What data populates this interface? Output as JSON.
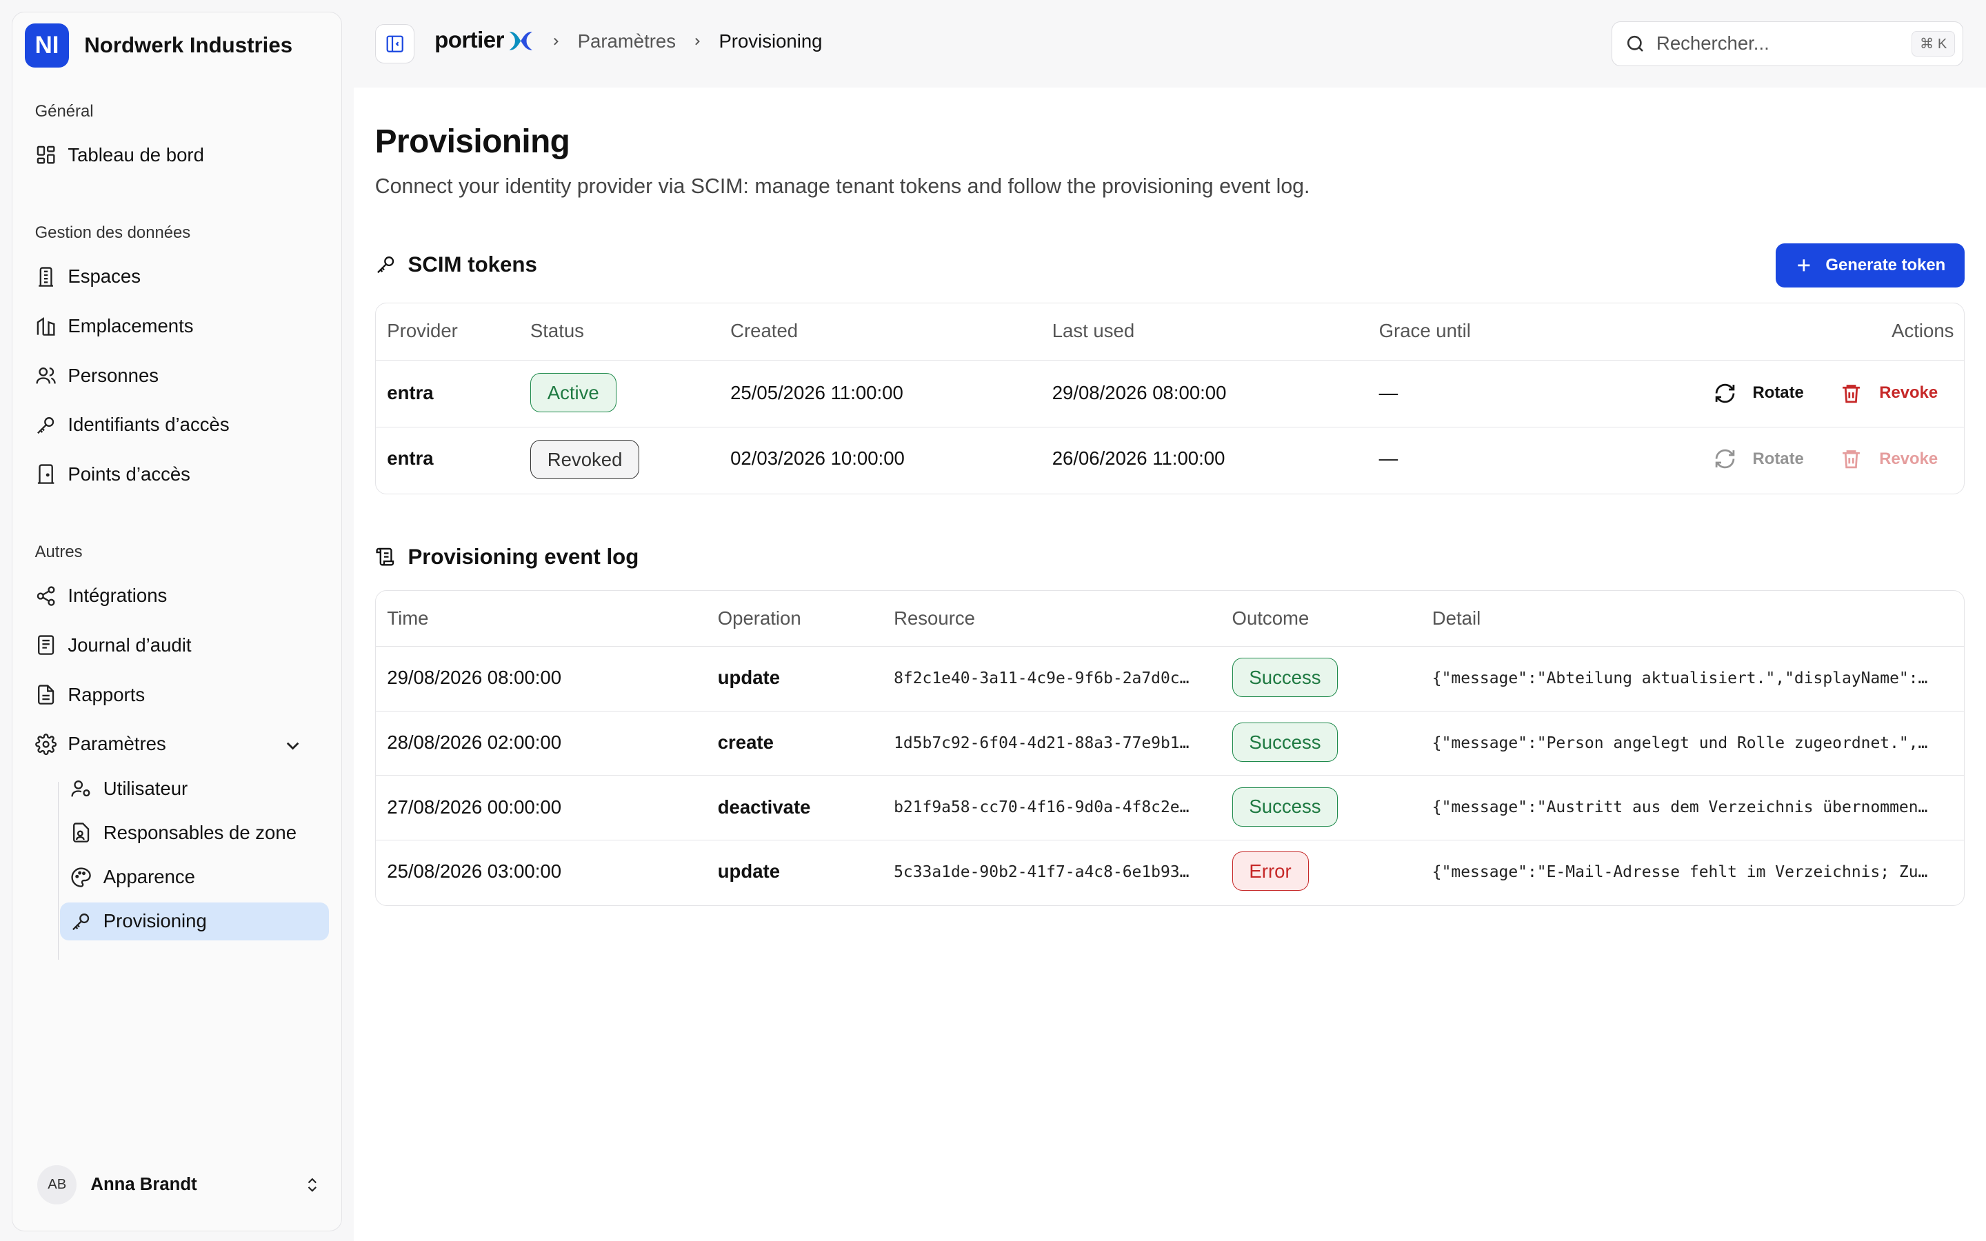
{
  "app": {
    "org_initials": "NI",
    "org_name": "Nordwerk Industries",
    "brand_color": "#1a47e0"
  },
  "sidebar": {
    "groups": [
      {
        "label": "Général"
      },
      {
        "label": "Gestion des données"
      },
      {
        "label": "Autres"
      }
    ],
    "items": [
      {
        "label": "Tableau de bord",
        "icon": "dashboard-icon"
      },
      {
        "label": "Espaces",
        "icon": "building-icon"
      },
      {
        "label": "Emplacements",
        "icon": "buildings-icon"
      },
      {
        "label": "Personnes",
        "icon": "users-icon"
      },
      {
        "label": "Identifiants d’accès",
        "icon": "key-icon"
      },
      {
        "label": "Points d’accès",
        "icon": "door-icon"
      },
      {
        "label": "Intégrations",
        "icon": "share-icon"
      },
      {
        "label": "Journal d’audit",
        "icon": "log-icon"
      },
      {
        "label": "Rapports",
        "icon": "report-icon"
      },
      {
        "label": "Paramètres",
        "icon": "gear-icon"
      }
    ],
    "sub_items": [
      {
        "label": "Utilisateur",
        "icon": "user-gear-icon"
      },
      {
        "label": "Responsables de zone",
        "icon": "zone-owner-icon"
      },
      {
        "label": "Apparence",
        "icon": "palette-icon"
      },
      {
        "label": "Provisioning",
        "icon": "key-icon",
        "active": true
      }
    ],
    "user": {
      "initials": "AB",
      "name": "Anna Brandt"
    }
  },
  "topbar": {
    "logo_text": "portier",
    "breadcrumb": [
      "Paramètres",
      "Provisioning"
    ],
    "search_placeholder": "Rechercher...",
    "search_shortcut": "⌘ K"
  },
  "page": {
    "title": "Provisioning",
    "description": "Connect your identity provider via SCIM: manage tenant tokens and follow the provisioning event log."
  },
  "tokens": {
    "title": "SCIM tokens",
    "generate_label": "Generate token",
    "columns": [
      "Provider",
      "Status",
      "Created",
      "Last used",
      "Grace until",
      "Actions"
    ],
    "rows": [
      {
        "provider": "entra",
        "status": "Active",
        "created": "25/05/2026 11:00:00",
        "last_used": "29/08/2026 08:00:00",
        "grace": "—",
        "rotate": "Rotate",
        "revoke": "Revoke"
      },
      {
        "provider": "entra",
        "status": "Revoked",
        "created": "02/03/2026 10:00:00",
        "last_used": "26/06/2026 11:00:00",
        "grace": "—",
        "rotate": "Rotate",
        "revoke": "Revoke"
      }
    ]
  },
  "events": {
    "title": "Provisioning event log",
    "columns": [
      "Time",
      "Operation",
      "Resource",
      "Outcome",
      "Detail"
    ],
    "rows": [
      {
        "time": "29/08/2026 08:00:00",
        "operation": "update",
        "resource": "8f2c1e40-3a11-4c9e-9f6b-2a7d0c…",
        "outcome": "Success",
        "detail": "{\"message\":\"Abteilung aktualisiert.\",\"displayName\":…"
      },
      {
        "time": "28/08/2026 02:00:00",
        "operation": "create",
        "resource": "1d5b7c92-6f04-4d21-88a3-77e9b1…",
        "outcome": "Success",
        "detail": "{\"message\":\"Person angelegt und Rolle zugeordnet.\",…"
      },
      {
        "time": "27/08/2026 00:00:00",
        "operation": "deactivate",
        "resource": "b21f9a58-cc70-4f16-9d0a-4f8c2e…",
        "outcome": "Success",
        "detail": "{\"message\":\"Austritt aus dem Verzeichnis übernommen…"
      },
      {
        "time": "25/08/2026 03:00:00",
        "operation": "update",
        "resource": "5c33a1de-90b2-41f7-a4c8-6e1b93…",
        "outcome": "Error",
        "detail": "{\"message\":\"E-Mail-Adresse fehlt im Verzeichnis; Zu…"
      }
    ]
  }
}
